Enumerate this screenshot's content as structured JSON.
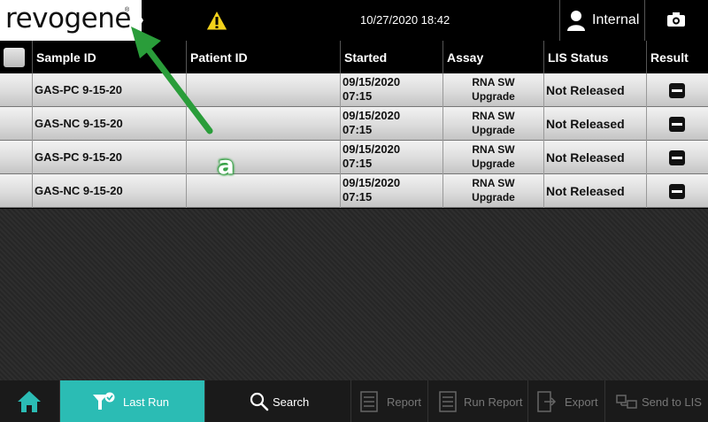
{
  "header": {
    "logo_text": "revogene",
    "logo_reg": "®",
    "datetime": "10/27/2020 18:42",
    "user_label": "Internal"
  },
  "table": {
    "columns": [
      "Sample ID",
      "Patient ID",
      "Started",
      "Assay",
      "LIS Status",
      "Result"
    ],
    "rows": [
      {
        "sample_id": "GAS-PC 9-15-20",
        "patient_id": "",
        "started_date": "09/15/2020",
        "started_time": "07:15",
        "assay_line1": "RNA SW",
        "assay_line2": "Upgrade",
        "lis_status": "Not Released"
      },
      {
        "sample_id": "GAS-NC 9-15-20",
        "patient_id": "",
        "started_date": "09/15/2020",
        "started_time": "07:15",
        "assay_line1": "RNA SW",
        "assay_line2": "Upgrade",
        "lis_status": "Not Released"
      },
      {
        "sample_id": "GAS-PC 9-15-20",
        "patient_id": "",
        "started_date": "09/15/2020",
        "started_time": "07:15",
        "assay_line1": "RNA SW",
        "assay_line2": "Upgrade",
        "lis_status": "Not Released"
      },
      {
        "sample_id": "GAS-NC 9-15-20",
        "patient_id": "",
        "started_date": "09/15/2020",
        "started_time": "07:15",
        "assay_line1": "RNA SW",
        "assay_line2": "Upgrade",
        "lis_status": "Not Released"
      }
    ]
  },
  "annotation": {
    "label": "a",
    "arrow_color": "#2a9d3a"
  },
  "bottom_bar": {
    "last_run": "Last Run",
    "search": "Search",
    "report": "Report",
    "run_report": "Run Report",
    "export": "Export",
    "send_to_lis": "Send to LIS"
  },
  "colors": {
    "accent": "#2bbcb4",
    "warning": "#f2d21b"
  },
  "icons": [
    "warning-icon",
    "user-icon",
    "camera-icon",
    "home-icon",
    "filter-check-icon",
    "search-icon",
    "report-icon",
    "run-report-icon",
    "export-icon",
    "send-to-lis-icon"
  ]
}
